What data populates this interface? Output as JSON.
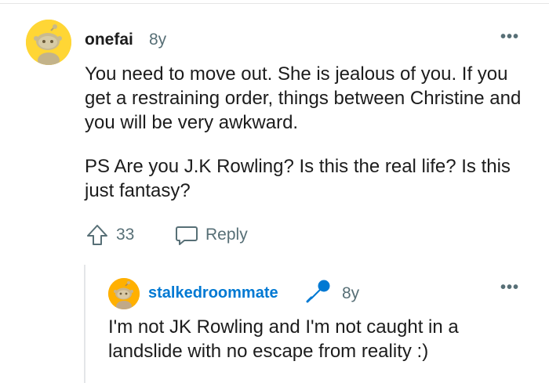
{
  "comment": {
    "username": "onefai",
    "age": "8y",
    "more_label": "•••",
    "paragraphs": [
      "You need to move out. She is jealous of you. If you get a restraining order, things between Christine and you will be very awkward.",
      "PS Are you J.K Rowling? Is this the real life? Is this just fantasy?"
    ],
    "vote_count": "33",
    "reply_label": "Reply",
    "avatar_color": "#ffd635"
  },
  "reply_comment": {
    "username": "stalkedroommate",
    "age": "8y",
    "more_label": "•••",
    "paragraphs": [
      "I'm not JK Rowling and I'm not caught in a landslide with no escape from reality :)"
    ],
    "avatar_color": "#ffb000",
    "username_color": "#0079d3",
    "badge_icon": "microphone-icon"
  },
  "icons": {
    "upvote": "upvote-arrow-icon",
    "reply": "speech-bubble-icon",
    "more": "ellipsis-icon"
  }
}
